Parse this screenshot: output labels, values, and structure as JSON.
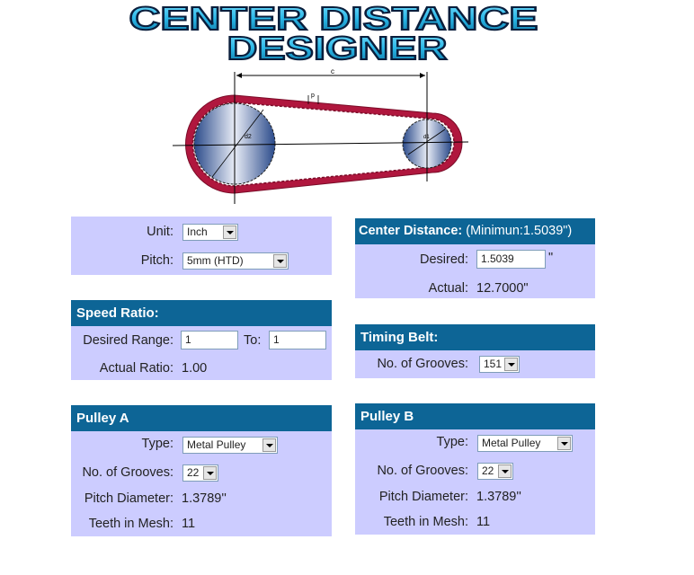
{
  "title": {
    "line1": "CENTER DISTANCE",
    "line2": "DESIGNER"
  },
  "diagram": {
    "c_label": "c",
    "p_label": "p",
    "d2_label": "d2",
    "d1_label": "d1"
  },
  "settings": {
    "unit_label": "Unit:",
    "unit_value": "Inch",
    "pitch_label": "Pitch:",
    "pitch_value": "5mm (HTD)"
  },
  "center_distance": {
    "header": "Center Distance:",
    "minimum": "(Minimun:1.5039\")",
    "desired_label": "Desired:",
    "desired_value": "1.5039",
    "desired_unit": "\"",
    "actual_label": "Actual:",
    "actual_value": "12.7000\""
  },
  "speed_ratio": {
    "header": "Speed Ratio:",
    "desired_range_label": "Desired Range:",
    "from_value": "1",
    "to_label": "To:",
    "to_value": "1",
    "actual_ratio_label": "Actual Ratio:",
    "actual_ratio_value": "1.00"
  },
  "timing_belt": {
    "header": "Timing Belt:",
    "grooves_label": "No. of Grooves:",
    "grooves_value": "151"
  },
  "pulley_a": {
    "header": "Pulley A",
    "type_label": "Type:",
    "type_value": "Metal Pulley",
    "grooves_label": "No. of Grooves:",
    "grooves_value": "22",
    "pitch_diameter_label": "Pitch Diameter:",
    "pitch_diameter_value": "1.3789''",
    "teeth_label": "Teeth in Mesh:",
    "teeth_value": "11"
  },
  "pulley_b": {
    "header": "Pulley B",
    "type_label": "Type:",
    "type_value": "Metal Pulley",
    "grooves_label": "No. of Grooves:",
    "grooves_value": "22",
    "pitch_diameter_label": "Pitch Diameter:",
    "pitch_diameter_value": "1.3789''",
    "teeth_label": "Teeth in Mesh:",
    "teeth_value": "11"
  },
  "colors": {
    "header_bg": "#0d6596",
    "panel_bg": "#ccccff",
    "belt": "#b0173e",
    "title_fill": "#2bb8e8"
  }
}
